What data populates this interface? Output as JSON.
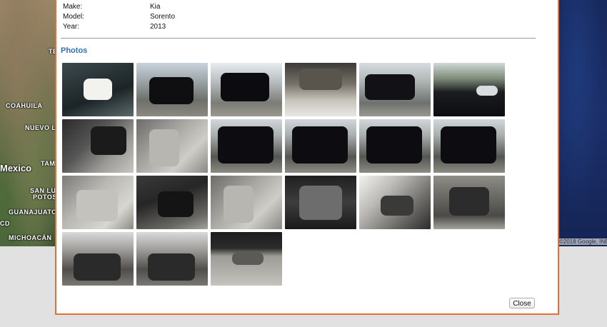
{
  "map": {
    "labels": [
      "TE",
      "COAHUILA",
      "NUEVO LE",
      "Mexico",
      "TAM",
      "SAN LU",
      "POTOS",
      "GUANAJUATO",
      "MICHOACÁN",
      "CD"
    ],
    "copyright": "©2018 Google, INE"
  },
  "vehicle": {
    "make_label": "Make:",
    "make": "Kia",
    "model_label": "Model:",
    "model": "Sorento",
    "year_label": "Year:",
    "year": "2013"
  },
  "photos": {
    "title": "Photos",
    "items": [
      {
        "subject": "windshield-sticker"
      },
      {
        "subject": "front-exterior"
      },
      {
        "subject": "front-side-exterior"
      },
      {
        "subject": "hood-underside"
      },
      {
        "subject": "side-exterior"
      },
      {
        "subject": "roof-exterior"
      },
      {
        "subject": "interior-driver-door"
      },
      {
        "subject": "front-seats"
      },
      {
        "subject": "rear-exterior"
      },
      {
        "subject": "rear-exterior"
      },
      {
        "subject": "rear-exterior"
      },
      {
        "subject": "rear-exterior"
      },
      {
        "subject": "rear-seat"
      },
      {
        "subject": "dashboard"
      },
      {
        "subject": "front-seats"
      },
      {
        "subject": "fuse-box"
      },
      {
        "subject": "interior-trim"
      },
      {
        "subject": "engine-cover"
      },
      {
        "subject": "engine-bay"
      },
      {
        "subject": "engine-bay"
      },
      {
        "subject": "undercarriage"
      }
    ]
  },
  "footer": {
    "close_label": "Close"
  }
}
